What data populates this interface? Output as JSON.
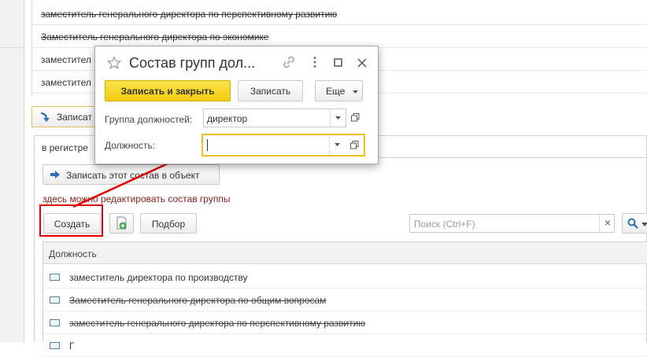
{
  "background": {
    "list_rows": [
      {
        "text": "заместитель генерального директора по перспективному развитию",
        "strike": true
      },
      {
        "text": "Заместитель генерального директора по экономике",
        "strike": true
      },
      {
        "text": "заместител",
        "strike": false
      },
      {
        "text": "заместител",
        "strike": false
      }
    ],
    "write_button_label": "Записат",
    "tab_label": "в регистре",
    "write_set_button_label": "Записать этот состав в объект",
    "hint_text": "здесь можно редактировать состав группы",
    "create_button_label": "Создать",
    "pick_button_label": "Подбор",
    "search_placeholder": "Поиск (Ctrl+F)",
    "clear_label": "×",
    "table_header": "Должность",
    "table_rows": [
      {
        "text": "заместитель директора по производству",
        "strike": false
      },
      {
        "text": "Заместитель генерального директора по общим вопросам",
        "strike": true
      },
      {
        "text": "заместитель генерального директора по перспективному развитию",
        "strike": true
      },
      {
        "text": "Г",
        "strike": false
      }
    ]
  },
  "dialog": {
    "title": "Состав групп дол...",
    "save_close_label": "Записать и закрыть",
    "save_label": "Записать",
    "more_label": "Еще",
    "group_label": "Группа должностей:",
    "group_value": "директор",
    "position_label": "Должность:",
    "position_value": ""
  },
  "colors": {
    "accent_yellow": "#f7d51b",
    "annotation_red": "#e20000",
    "focus_border": "#f0c020"
  }
}
